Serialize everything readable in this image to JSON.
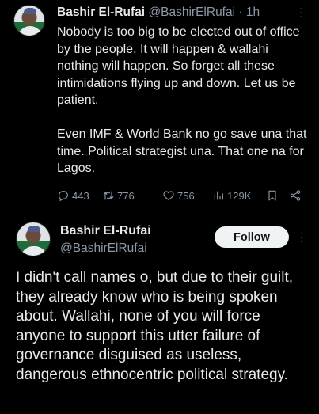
{
  "tweet1": {
    "author_name": "Bashir El-Rufai",
    "handle_time": "@BashirElRufai · 1h",
    "paragraph1": "Nobody is too big to be elected out of office by the people. It will happen & wallahi nothing will happen. So forget all these intimidations flying up and down. Let us be patient.",
    "paragraph2": "Even IMF & World Bank no go save una that time. Political strategist una. That one na for Lagos.",
    "replies": "443",
    "retweets": "776",
    "likes": "756",
    "views": "129K",
    "icons": [
      "reply-icon",
      "retweet-icon",
      "like-icon",
      "views-icon",
      "bookmark-icon",
      "share-icon",
      "more-icon"
    ]
  },
  "tweet2": {
    "author_name": "Bashir El-Rufai",
    "handle": "@BashirElRufai",
    "follow_label": "Follow",
    "text": "I didn't call names o, but due to their guilt, they already know who is being spoken about. Wallahi, none of you will force anyone to support this utter failure of governance disguised as useless, dangerous ethnocentric political strategy."
  },
  "colors": {
    "background": "#000000",
    "text": "#e7e9ea",
    "muted": "#8b98a5",
    "follow_bg": "#eff3f4"
  }
}
